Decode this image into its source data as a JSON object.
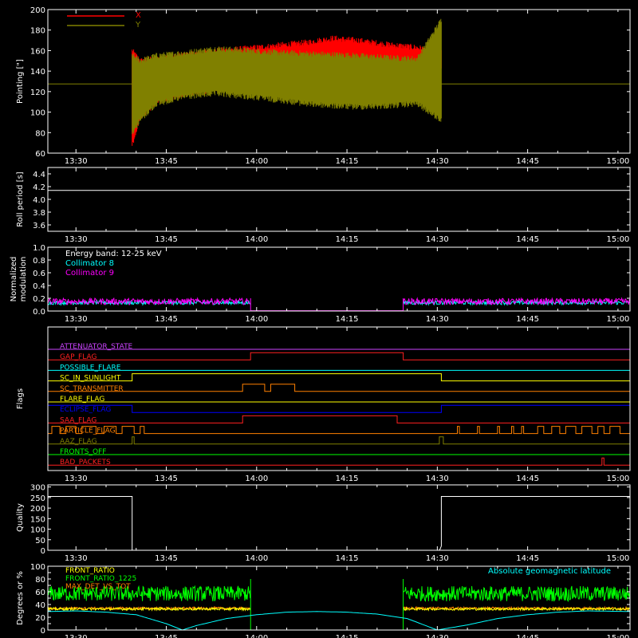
{
  "colors": {
    "background": "#000000",
    "axis": "#ffffff",
    "x_pointing": "#ff0000",
    "y_pointing": "#808000",
    "collimator_8": "#00ffff",
    "collimator_9": "#ff00ff",
    "front_ratio": "#ffff00",
    "front_ratio_1225": "#00ff00",
    "max_det_vs_tot": "#ff8000",
    "geomag_latitude": "#00ffff"
  },
  "time_axis": {
    "range_min": [
      1276,
      1566
    ],
    "tick_minutes": [
      1290,
      1305,
      1320,
      1335,
      1350,
      1365,
      1380,
      1395,
      1410,
      1425,
      1440,
      1455,
      1470,
      1485,
      1500,
      1515,
      1530,
      1545,
      1560
    ],
    "major_minutes": [
      1290,
      1335,
      1380,
      1425,
      1470,
      1515
    ],
    "major_labels": [
      "13:30",
      "13:45",
      "14:00",
      "14:15",
      "14:30",
      "14:45",
      "15:00"
    ]
  },
  "chart_data": [
    {
      "type": "line",
      "panel": "pointing",
      "ylabel": "Pointing [\"]",
      "ylim": [
        60,
        200
      ],
      "yticks": [
        60,
        80,
        100,
        120,
        140,
        160,
        180,
        200
      ],
      "grid": false,
      "legend": [
        "X",
        "Y"
      ],
      "legend_position": "top-left",
      "series": [
        {
          "name": "X",
          "color": "#ff0000",
          "envelope": {
            "t": [
              1318,
              1322,
              1330,
              1345,
              1360,
              1375,
              1390,
              1405,
              1418,
              1430,
              1445,
              1460,
              1472
            ],
            "max": [
              160,
              150,
              152,
              156,
              160,
              162,
              165,
              168,
              172,
              170,
              166,
              163,
              158
            ],
            "min": [
              68,
              95,
              110,
              118,
              122,
              124,
              126,
              130,
              135,
              138,
              140,
              143,
              145
            ]
          }
        },
        {
          "name": "Y",
          "color": "#808000",
          "baseline_before": 127.5,
          "baseline_after": 127.5,
          "envelope": {
            "t": [
              1318,
              1322,
              1330,
              1345,
              1360,
              1375,
              1390,
              1405,
              1418,
              1430,
              1445,
              1460,
              1472
            ],
            "max": [
              155,
              150,
              155,
              158,
              162,
              160,
              158,
              157,
              156,
              155,
              153,
              152,
              190
            ],
            "min": [
              80,
              92,
              108,
              115,
              118,
              115,
              112,
              108,
              106,
              105,
              106,
              108,
              92
            ]
          }
        }
      ]
    },
    {
      "type": "line",
      "panel": "roll_period",
      "ylabel": "Roll period [s]",
      "ylim": [
        3.5,
        4.5
      ],
      "yticks": [
        3.6,
        3.8,
        4.0,
        4.2,
        4.4
      ],
      "ytick_labels": [
        "3.6",
        "3.8",
        "4.0",
        "4.2",
        "4.4"
      ],
      "series": [
        {
          "name": "",
          "color": "#ffffff",
          "x": [
            1276,
            1566
          ],
          "y": [
            4.14,
            4.14
          ]
        }
      ]
    },
    {
      "type": "line",
      "panel": "modulation",
      "ylabel": [
        "Normalized",
        "modulation"
      ],
      "ylim": [
        0,
        1.0
      ],
      "yticks": [
        0.0,
        0.2,
        0.4,
        0.6,
        0.8,
        1.0
      ],
      "ytick_labels": [
        "0.0",
        "0.2",
        "0.4",
        "0.6",
        "0.8",
        "1.0"
      ],
      "annotation": "Energy band: 12-25 keV",
      "legend": [
        "Collimator 8",
        "Collimator 9"
      ],
      "legend_position": "top-left",
      "series": [
        {
          "name": "Collimator 8",
          "color": "#00ffff",
          "segments": [
            [
              1276,
              1377
            ],
            [
              1453,
              1566
            ]
          ],
          "level": 0.13,
          "noise": 0.03
        },
        {
          "name": "Collimator 9",
          "color": "#ff00ff",
          "segments": [
            [
              1276,
              1377
            ],
            [
              1453,
              1566
            ]
          ],
          "level": 0.15,
          "noise": 0.05
        }
      ]
    },
    {
      "type": "line",
      "panel": "flags",
      "ylabel": "Flags",
      "flags": [
        {
          "name": "ATTENUATOR_STATE",
          "color": "#cc44ff",
          "high": []
        },
        {
          "name": "GAP_FLAG",
          "color": "#ff2020",
          "high": [
            [
              1377,
              1453
            ]
          ]
        },
        {
          "name": "POSSIBLE_FLARE",
          "color": "#00ffff",
          "high": []
        },
        {
          "name": "SC_IN_SUNLIGHT",
          "color": "#ffff00",
          "high": [
            [
              1318,
              1472
            ]
          ]
        },
        {
          "name": "SC_TRANSMITTER",
          "color": "#ff8000",
          "high": [
            [
              1373,
              1384
            ],
            [
              1387,
              1399
            ]
          ]
        },
        {
          "name": "FLARE_FLAG",
          "color": "#ffff00",
          "high": []
        },
        {
          "name": "ECLIPSE_FLAG",
          "color": "#0000ff",
          "high": [
            [
              1276,
              1318
            ],
            [
              1472,
              1566
            ]
          ]
        },
        {
          "name": "SAA_FLAG",
          "color": "#ff2020",
          "high": [
            [
              1373,
              1450
            ]
          ]
        },
        {
          "name": "PARTICLE_FLAG",
          "color": "#ff8000",
          "high": [
            [
              1278,
              1282
            ],
            [
              1285,
              1290
            ],
            [
              1293,
              1300
            ],
            [
              1304,
              1310
            ],
            [
              1313,
              1319
            ],
            [
              1322,
              1324
            ],
            [
              1480,
              1481
            ],
            [
              1490,
              1491
            ],
            [
              1500,
              1501
            ],
            [
              1507,
              1508
            ],
            [
              1512,
              1513
            ],
            [
              1520,
              1523
            ],
            [
              1527,
              1531
            ],
            [
              1534,
              1539
            ],
            [
              1542,
              1547
            ],
            [
              1550,
              1553
            ],
            [
              1556,
              1561
            ]
          ]
        },
        {
          "name": "AAZ_FLAG",
          "color": "#808000",
          "high": [
            [
              1318,
              1319
            ],
            [
              1471,
              1473
            ]
          ]
        },
        {
          "name": "FRONTS_OFF",
          "color": "#00ff00",
          "high": []
        },
        {
          "name": "BAD_PACKETS",
          "color": "#ff2020",
          "high": [
            [
              1552,
              1553
            ]
          ]
        }
      ]
    },
    {
      "type": "line",
      "panel": "quality",
      "ylabel": "Quality",
      "ylim": [
        0,
        310
      ],
      "yticks": [
        0,
        50,
        100,
        150,
        200,
        250,
        300
      ],
      "series": [
        {
          "name": "",
          "color": "#ffffff",
          "x": [
            1276,
            1318,
            1318,
            1471,
            1471.4,
            1472,
            1472,
            1566
          ],
          "y": [
            255,
            255,
            0,
            0,
            6,
            20,
            255,
            255
          ]
        }
      ]
    },
    {
      "type": "line",
      "panel": "ratios",
      "ylabel": "Degrees or %",
      "ylim": [
        0,
        100
      ],
      "yticks": [
        0,
        10,
        20,
        30,
        40,
        50,
        60,
        70,
        80,
        90,
        100
      ],
      "ytick_labels": [
        "0",
        "",
        "20",
        "",
        "40",
        "",
        "60",
        "",
        "80",
        "",
        "100"
      ],
      "legend": [
        "FRONT_RATIO",
        "FRONT_RATIO_1225",
        "MAX_DET_VS_TOT"
      ],
      "legend_position": "top-left",
      "annotation": "Absolute geomagnetic latitude",
      "series": [
        {
          "name": "FRONT_RATIO",
          "color": "#ffff00",
          "segments": [
            [
              1276,
              1377
            ],
            [
              1453,
              1566
            ]
          ],
          "level": 33,
          "noise": 2
        },
        {
          "name": "FRONT_RATIO_1225",
          "color": "#00ff00",
          "segments": [
            [
              1276,
              1377
            ],
            [
              1453,
              1566
            ]
          ],
          "level": 57,
          "noise": 12
        },
        {
          "name": "MAX_DET_VS_TOT",
          "color": "#ff8000",
          "segments": [
            [
              1276,
              1377
            ],
            [
              1453,
              1566
            ]
          ],
          "level": 34,
          "noise": 2
        },
        {
          "name": "Absolute geomagnetic latitude",
          "color": "#00ffff",
          "x": [
            1276,
            1290,
            1305,
            1320,
            1335,
            1343,
            1350,
            1365,
            1380,
            1395,
            1410,
            1425,
            1440,
            1455,
            1465,
            1470,
            1485,
            1500,
            1515,
            1530,
            1545,
            1566
          ],
          "y": [
            29,
            30,
            28,
            24,
            10,
            0,
            7,
            18,
            24,
            28,
            29,
            28,
            25,
            18,
            6,
            0,
            8,
            18,
            24,
            28,
            30,
            29
          ]
        }
      ]
    }
  ]
}
